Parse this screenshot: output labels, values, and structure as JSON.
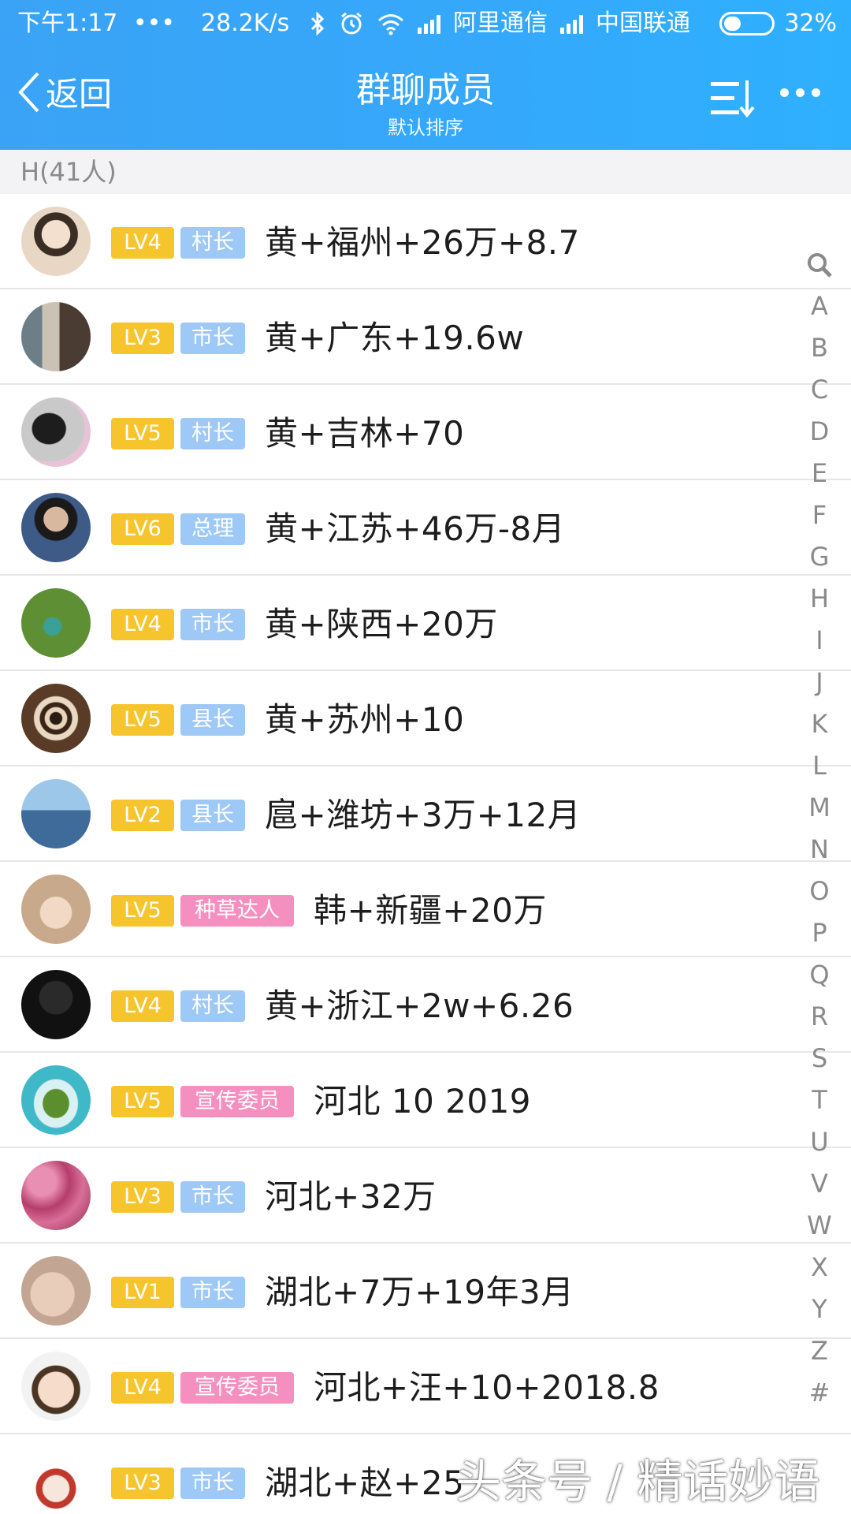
{
  "status_bar": {
    "time": "下午1:17",
    "dots": "•••",
    "speed": "28.2K/s",
    "carrier1": "阿里通信",
    "carrier2": "中国联通",
    "battery": "32%"
  },
  "header": {
    "back_label": "返回",
    "title": "群聊成员",
    "subtitle": "默认排序"
  },
  "section": {
    "label": "H(41人)"
  },
  "members": [
    {
      "level": "LV4",
      "role": "村长",
      "role_color": "#9ec8f5",
      "name": "黄+福州+26万+8.7"
    },
    {
      "level": "LV3",
      "role": "市长",
      "role_color": "#9ec8f5",
      "name": "黄+广东+19.6w"
    },
    {
      "level": "LV5",
      "role": "村长",
      "role_color": "#9ec8f5",
      "name": "黄+吉林+70"
    },
    {
      "level": "LV6",
      "role": "总理",
      "role_color": "#9ec8f5",
      "name": "黄+江苏+46万-8月"
    },
    {
      "level": "LV4",
      "role": "市长",
      "role_color": "#9ec8f5",
      "name": "黄+陕西+20万"
    },
    {
      "level": "LV5",
      "role": "县长",
      "role_color": "#9ec8f5",
      "name": "黄+苏州+10"
    },
    {
      "level": "LV2",
      "role": "县长",
      "role_color": "#9ec8f5",
      "name": "扈+潍坊+3万+12月"
    },
    {
      "level": "LV5",
      "role": "种草达人",
      "role_color": "#f48fbf",
      "name": "韩+新疆+20万"
    },
    {
      "level": "LV4",
      "role": "村长",
      "role_color": "#9ec8f5",
      "name": "黄+浙江+2w+6.26"
    },
    {
      "level": "LV5",
      "role": "宣传委员",
      "role_color": "#f48fbf",
      "name": "河北 10 2019"
    },
    {
      "level": "LV3",
      "role": "市长",
      "role_color": "#9ec8f5",
      "name": "河北+32万"
    },
    {
      "level": "LV1",
      "role": "市长",
      "role_color": "#9ec8f5",
      "name": "湖北+7万+19年3月"
    },
    {
      "level": "LV4",
      "role": "宣传委员",
      "role_color": "#f48fbf",
      "name": "河北+汪+10+2018.8"
    },
    {
      "level": "LV3",
      "role": "市长",
      "role_color": "#9ec8f5",
      "name": "湖北+赵+25"
    }
  ],
  "alpha_index": [
    "A",
    "B",
    "C",
    "D",
    "E",
    "F",
    "G",
    "H",
    "I",
    "J",
    "K",
    "L",
    "M",
    "N",
    "O",
    "P",
    "Q",
    "R",
    "S",
    "T",
    "U",
    "V",
    "W",
    "X",
    "Y",
    "Z",
    "#"
  ],
  "watermark": "头条号 / 精话妙语",
  "colors": {
    "header_blue": "#35a8fb",
    "level_badge": "#f6c52e",
    "role_badge_blue": "#9ec8f5",
    "role_badge_pink": "#f48fbf"
  }
}
